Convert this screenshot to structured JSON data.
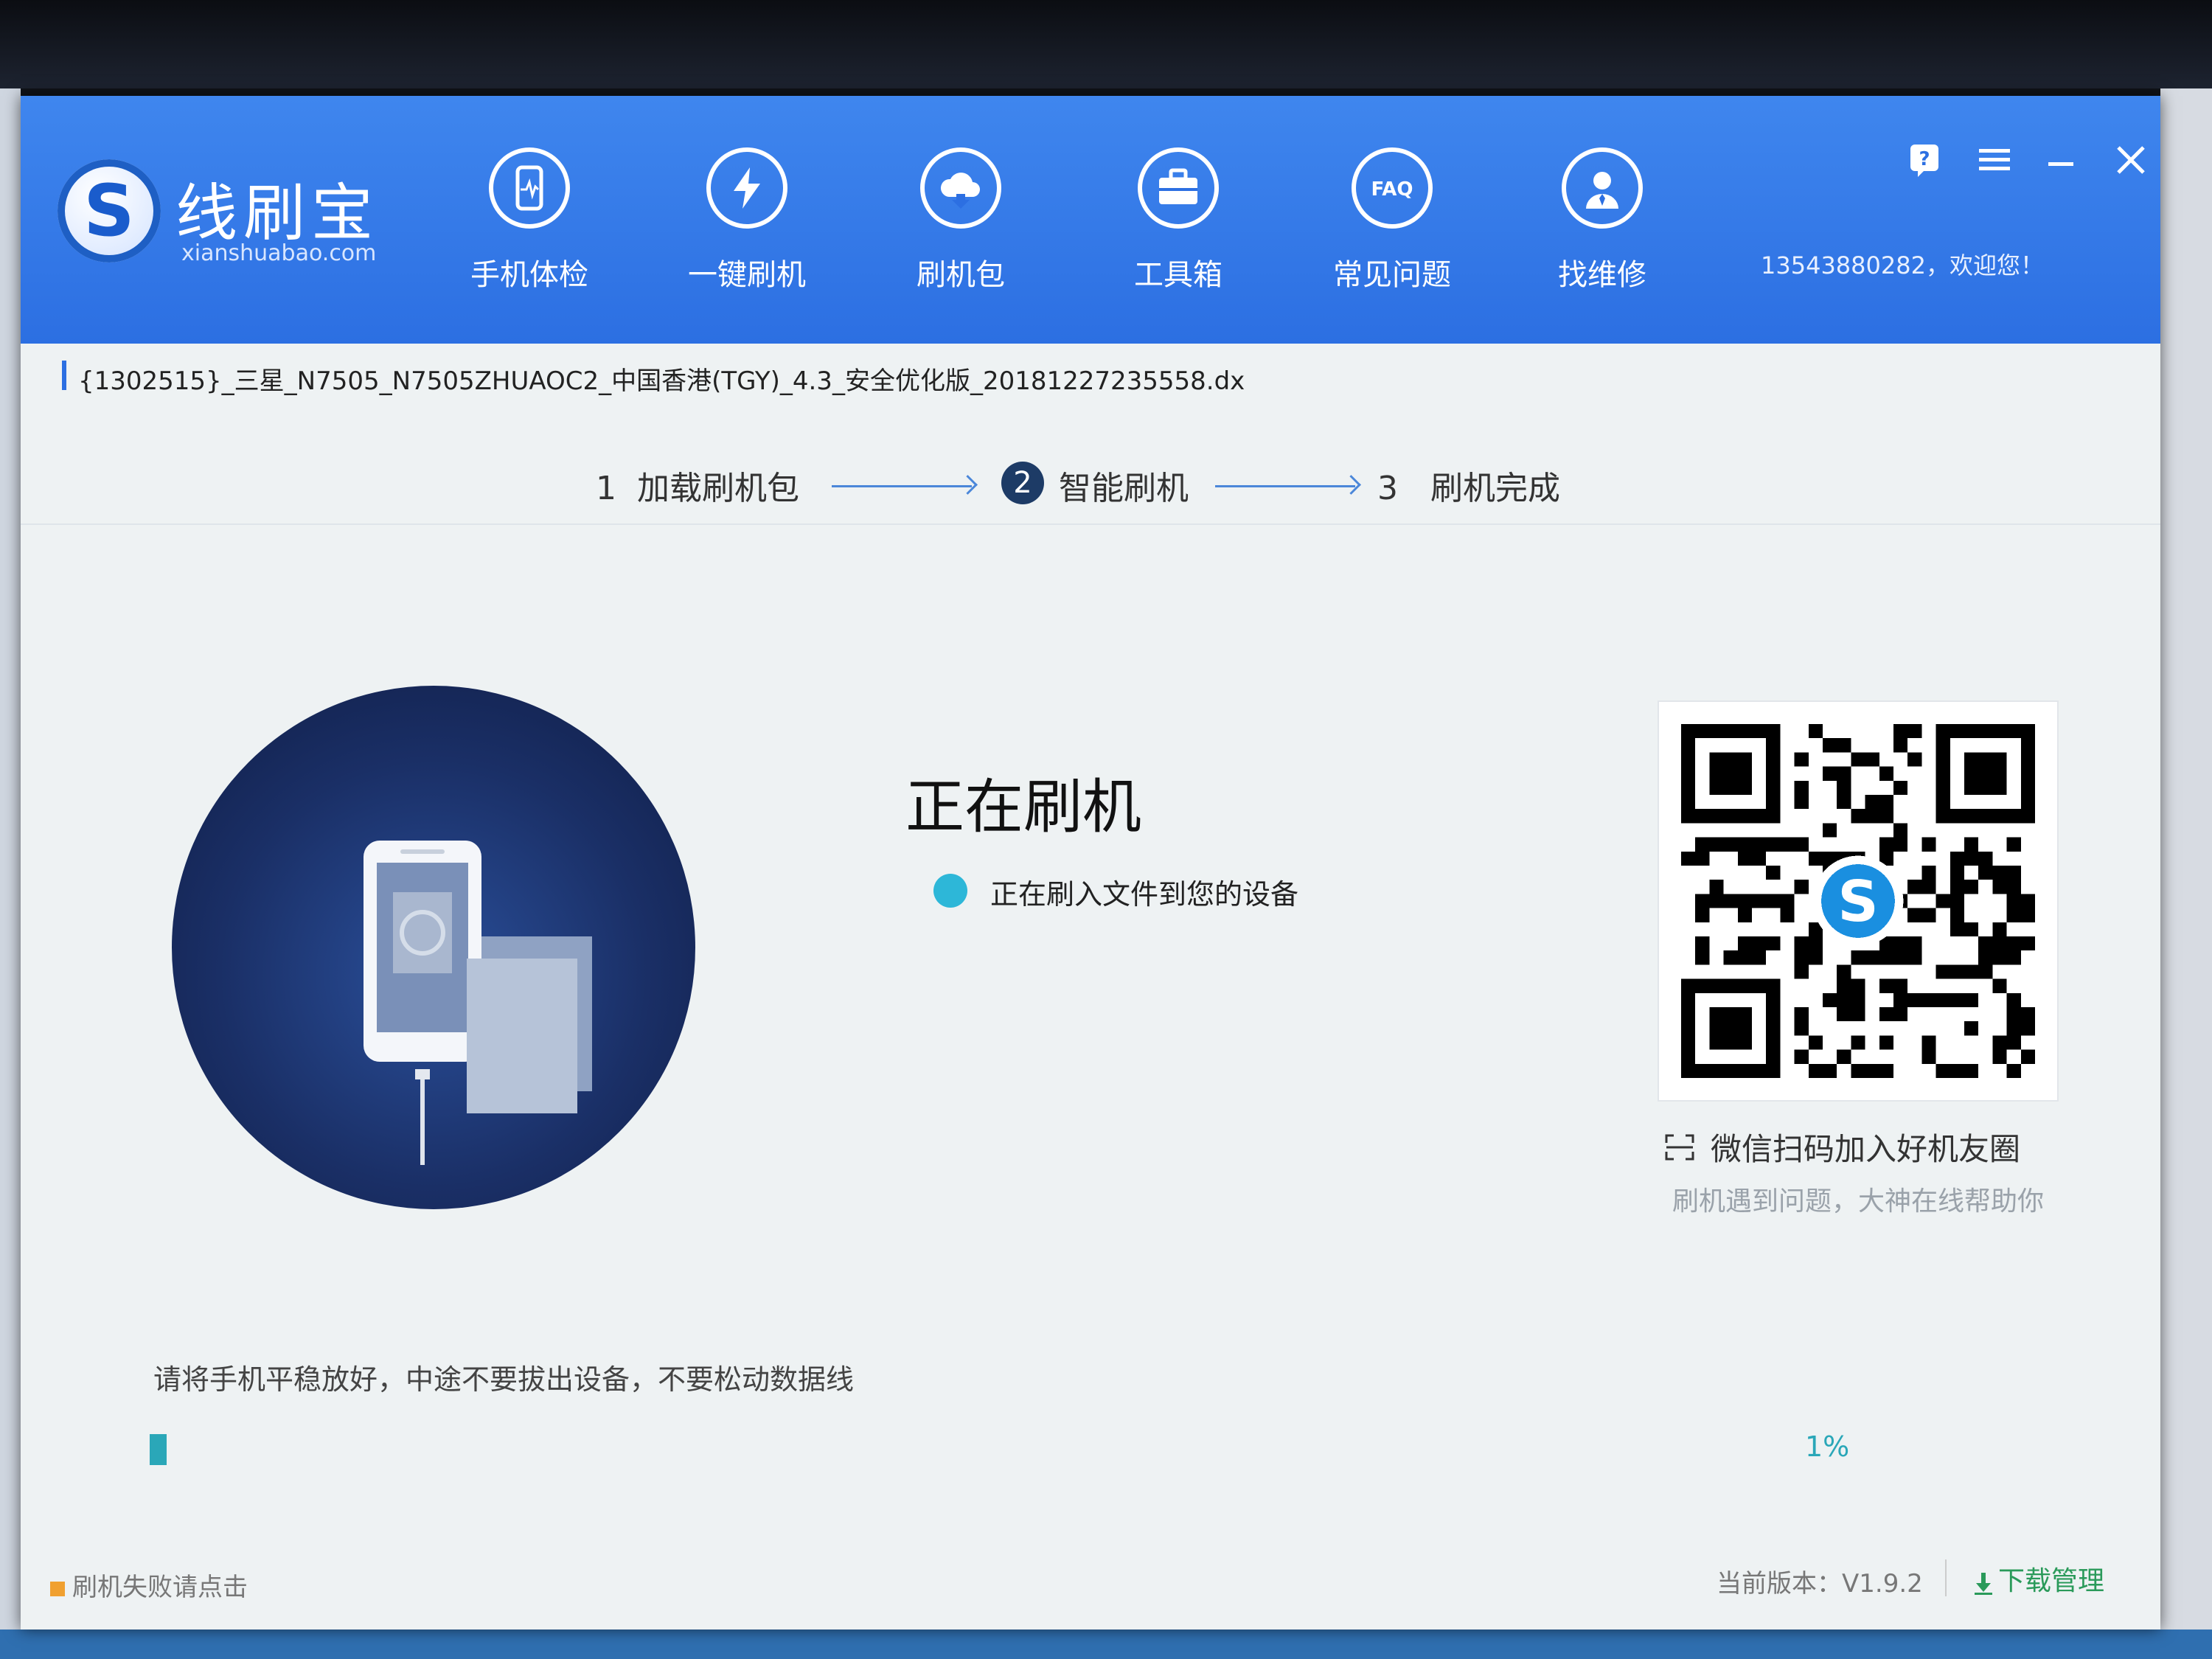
{
  "app": {
    "logo_letter": "S",
    "title": "线刷宝",
    "subtitle": "xianshuabao.com"
  },
  "nav": [
    {
      "label": "手机体检",
      "icon": "phone-check-icon"
    },
    {
      "label": "一键刷机",
      "icon": "lightning-icon"
    },
    {
      "label": "刷机包",
      "icon": "cloud-download-icon"
    },
    {
      "label": "工具箱",
      "icon": "toolbox-icon"
    },
    {
      "label": "常见问题",
      "icon": "faq-icon",
      "icon_text": "FAQ"
    },
    {
      "label": "找维修",
      "icon": "repair-person-icon"
    }
  ],
  "window_controls": [
    "help-icon",
    "menu-icon",
    "minimize-icon",
    "close-icon"
  ],
  "welcome": "13543880282，欢迎您！",
  "file_name": "{1302515}_三星_N7505_N7505ZHUAOC2_中国香港(TGY)_4.3_安全优化版_20181227235558.dx",
  "steps": [
    {
      "num": "1",
      "label": "加载刷机包",
      "active": false
    },
    {
      "num": "2",
      "label": "智能刷机",
      "active": true
    },
    {
      "num": "3",
      "label": "刷机完成",
      "active": false
    }
  ],
  "status": {
    "title": "正在刷机",
    "detail": "正在刷入文件到您的设备"
  },
  "qr": {
    "caption": "微信扫码加入好机友圈",
    "subcaption": "刷机遇到问题，大神在线帮助你",
    "center_letter": "S"
  },
  "notice": "请将手机平稳放好，中途不要拔出设备，不要松动数据线",
  "progress": {
    "value": 0.01,
    "label": "1%"
  },
  "footer": {
    "fail_link": "刷机失败请点击",
    "version": "当前版本：V1.9.2",
    "download": "下载管理"
  },
  "colors": {
    "header": "#2c6fe2",
    "progress": "#2aa7b8",
    "status_dot": "#2db7d8",
    "download": "#2a9a5a"
  }
}
